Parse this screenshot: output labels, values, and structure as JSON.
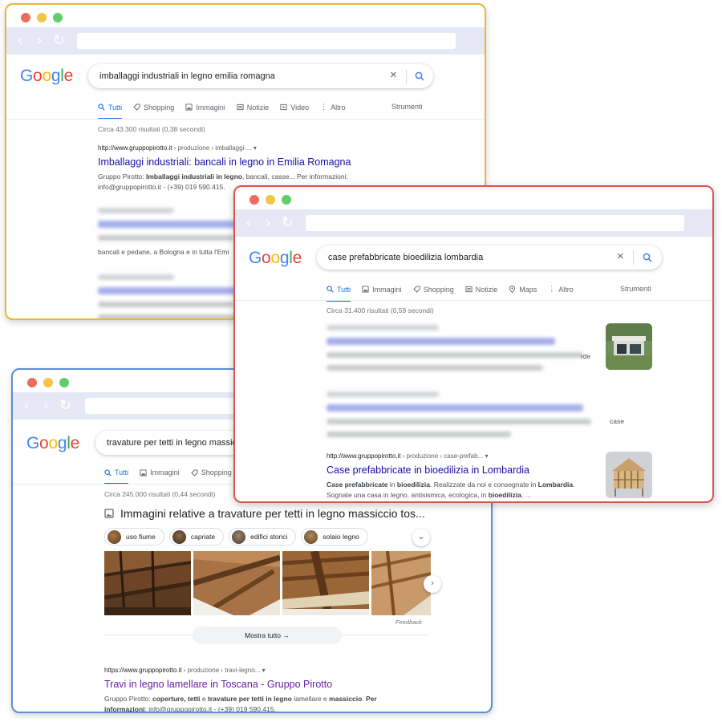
{
  "logo_text": [
    "G",
    "o",
    "o",
    "g",
    "l",
    "e"
  ],
  "window_yellow": {
    "query": "imballaggi industriali in legno emilia romagna",
    "tabs": [
      "Tutti",
      "Shopping",
      "Immagini",
      "Notizie",
      "Video",
      "Altro"
    ],
    "tools": "Strumenti",
    "stats": "Circa 43.300 risultati (0,38 secondi)",
    "result": {
      "cite_domain": "http://www.gruppopirotto.it",
      "cite_path": " › produzione › imballaggi-...",
      "title": "Imballaggi industriali: bancali in legno in Emilia Romagna",
      "snippet_line1_pre": "Gruppo Pirotto: ",
      "snippet_line1_bold": "Imballaggi industriali in legno",
      "snippet_line1_post": ", bancali, casse... Per informazioni:",
      "snippet_line2": "info@gruppopirotto.it - (+39) 019 590.415."
    },
    "partial_snippet": "bancali e pedane, a Bologna e in tutta l'Emi"
  },
  "window_red": {
    "query": "case prefabbricate bioedilizia lombardia",
    "tabs": [
      "Tutti",
      "Immagini",
      "Shopping",
      "Notizie",
      "Maps",
      "Altro"
    ],
    "tools": "Strumenti",
    "stats": "Circa 31.400 risultati (0,59 secondi)",
    "partial_snippet_1": "rde",
    "partial_snippet_2": "case",
    "result": {
      "cite_domain": "http://www.gruppopirotto.it",
      "cite_path": " › produzione › case-prefab...",
      "title": "Case prefabbricate in bioedilizia in Lombardia",
      "snippet_l1_b1": "Case prefabbricate",
      "snippet_l1_t1": " in ",
      "snippet_l1_b2": "bioedilizia",
      "snippet_l1_t2": ". Realizzate da noi e consegnate in ",
      "snippet_l1_b3": "Lombardia",
      "snippet_l1_t3": ".",
      "snippet_l2_t1": "Sognate una casa in legno, antisismica, ecologica, in ",
      "snippet_l2_b1": "bioedilizia",
      "snippet_l2_t2": ", ..."
    }
  },
  "window_blue": {
    "query": "travature per tetti in legno massiccio",
    "tabs": [
      "Tutti",
      "Immagini",
      "Shopping"
    ],
    "stats": "Circa 245.000 risultati (0,44 secondi)",
    "images_heading": "Immagini relative a travature per tetti in legno massiccio tos...",
    "chips": [
      "uso fiume",
      "capriate",
      "edifici storici",
      "solaio legno"
    ],
    "feedback": "Feedback",
    "show_all": "Mostra tutto →",
    "result": {
      "cite_domain": "https://www.gruppopirotto.it",
      "cite_path": " › produzione › travi-legno...",
      "title": "Travi in legno lamellare in Toscana - Gruppo Pirotto",
      "snippet_l1_t1": "Gruppo Pirotto: ",
      "snippet_l1_b1": "coperture, tetti",
      "snippet_l1_t2": " e ",
      "snippet_l1_b2": "travature per tetti in legno",
      "snippet_l1_t3": " lamellare e ",
      "snippet_l1_b3": "massiccio",
      "snippet_l1_t4": ". ",
      "snippet_l1_b4": "Per",
      "snippet_l2_b1": "informazioni",
      "snippet_l2_t1": ": info@gruppopirotto.it - (+39) 019 590.415."
    }
  }
}
